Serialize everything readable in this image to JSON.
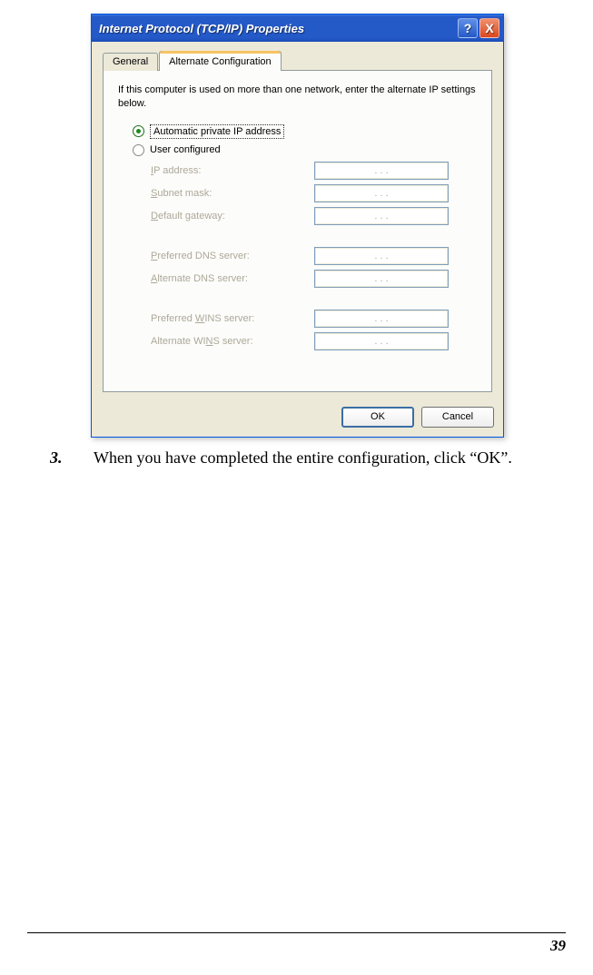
{
  "dialog": {
    "title": "Internet Protocol (TCP/IP) Properties",
    "helpGlyph": "?",
    "closeGlyph": "X",
    "tabs": {
      "general": "General",
      "alternate": "Alternate Configuration"
    },
    "description": "If this computer is used on more than one network, enter the alternate IP settings below.",
    "radios": {
      "auto": "Automatic private IP address",
      "user": "User configured"
    },
    "fields": {
      "ip": {
        "u": "I",
        "rest": "P address:"
      },
      "subnet": {
        "u": "S",
        "rest": "ubnet mask:"
      },
      "gateway": {
        "u": "D",
        "rest": "efault gateway:"
      },
      "pdns": {
        "u": "P",
        "rest": "referred DNS server:"
      },
      "adns": {
        "u": "A",
        "rest": "lternate DNS server:"
      },
      "pwins": {
        "pre": "Preferred ",
        "u": "W",
        "rest": "INS server:"
      },
      "awins": {
        "pre": "Alternate WI",
        "u": "N",
        "rest": "S server:"
      }
    },
    "ipDots": ".       .       .",
    "buttons": {
      "ok": "OK",
      "cancel": "Cancel"
    }
  },
  "instruction": {
    "num": "3.",
    "text": "When you have completed the entire configuration, click “OK”."
  },
  "pageNumber": "39"
}
